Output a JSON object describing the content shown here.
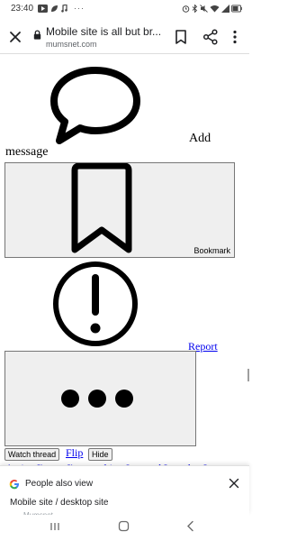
{
  "status_bar": {
    "time": "23:40",
    "more_indicator": "···"
  },
  "toolbar": {
    "title": "Mobile site is all but br...",
    "domain": "mumsnet.com",
    "icons": [
      "close-icon",
      "lock-icon",
      "bookmark-add-icon",
      "share-icon",
      "more-vert-icon"
    ]
  },
  "page": {
    "add_label": "Add",
    "message_label": "message",
    "bookmark_label": "Bookmark",
    "report_label": "Report",
    "watch_thread_label": "Watch thread",
    "flip_label": "Flip",
    "hide_label": "Hide",
    "filter_links": [
      "Active",
      "I'm on",
      "I'm watching",
      "I started",
      "Last day",
      "Last"
    ]
  },
  "bottom_sheet": {
    "header": "People also view",
    "item": "Mobile site / desktop site",
    "sub": "Mumsnet"
  },
  "colors": {
    "link": "#0000ee",
    "button_bg": "#efefef",
    "button_border": "#767676",
    "google_blue": "#4285f4"
  }
}
